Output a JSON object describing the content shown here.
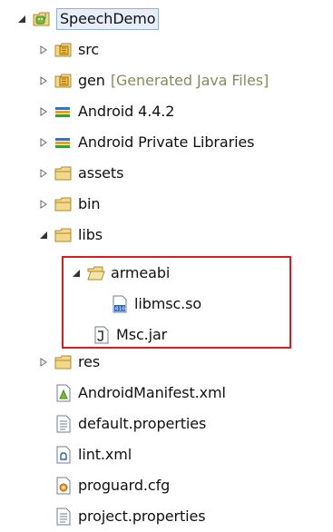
{
  "tree": {
    "root": {
      "label": "SpeechDemo",
      "expanded": true,
      "icon": "android-project-icon"
    },
    "items": [
      {
        "label": "src",
        "expanded": false,
        "icon": "source-folder-icon"
      },
      {
        "label": "gen",
        "decoration": "[Generated Java Files]",
        "expanded": false,
        "icon": "generated-folder-icon"
      },
      {
        "label": "Android 4.4.2",
        "expanded": false,
        "icon": "library-icon"
      },
      {
        "label": "Android Private Libraries",
        "expanded": false,
        "icon": "library-icon"
      },
      {
        "label": "assets",
        "expanded": false,
        "icon": "folder-icon"
      },
      {
        "label": "bin",
        "expanded": false,
        "icon": "folder-icon"
      },
      {
        "label": "libs",
        "expanded": true,
        "icon": "folder-icon",
        "children": [
          {
            "label": "armeabi",
            "expanded": true,
            "icon": "open-folder-icon",
            "children": [
              {
                "label": "libmsc.so",
                "icon": "binary-file-icon"
              }
            ]
          },
          {
            "label": "Msc.jar",
            "icon": "jar-file-icon"
          }
        ]
      },
      {
        "label": "res",
        "expanded": false,
        "icon": "folder-icon"
      },
      {
        "label": "AndroidManifest.xml",
        "icon": "manifest-file-icon"
      },
      {
        "label": "default.properties",
        "icon": "text-file-icon"
      },
      {
        "label": "lint.xml",
        "icon": "xml-file-icon"
      },
      {
        "label": "proguard.cfg",
        "icon": "config-file-icon"
      },
      {
        "label": "project.properties",
        "icon": "text-file-icon"
      }
    ]
  },
  "colors": {
    "highlight_border": "#e01b1b",
    "decoration_text": "#8a8a5a",
    "folder_yellow": "#e8c050",
    "selection_bg": "#e8eef8"
  }
}
